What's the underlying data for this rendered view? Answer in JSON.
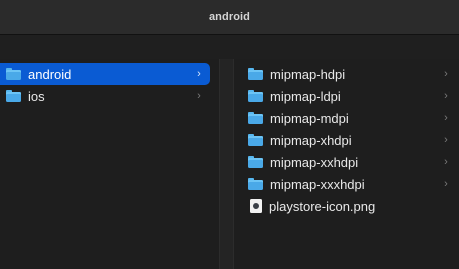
{
  "window": {
    "title": "android"
  },
  "column1": {
    "items": [
      {
        "label": "android",
        "icon": "folder-icon",
        "chevron": "›"
      },
      {
        "label": "ios",
        "icon": "folder-icon",
        "chevron": "›"
      }
    ]
  },
  "column2": {
    "items": [
      {
        "label": "mipmap-hdpi",
        "icon": "folder-icon",
        "chevron": "›"
      },
      {
        "label": "mipmap-ldpi",
        "icon": "folder-icon",
        "chevron": "›"
      },
      {
        "label": "mipmap-mdpi",
        "icon": "folder-icon",
        "chevron": "›"
      },
      {
        "label": "mipmap-xhdpi",
        "icon": "folder-icon",
        "chevron": "›"
      },
      {
        "label": "mipmap-xxhdpi",
        "icon": "folder-icon",
        "chevron": "›"
      },
      {
        "label": "mipmap-xxxhdpi",
        "icon": "folder-icon",
        "chevron": "›"
      },
      {
        "label": "playstore-icon.png",
        "icon": "image-file-icon"
      }
    ]
  },
  "colors": {
    "selection": "#0a5bd3",
    "folder": "#4aa9e8",
    "background": "#1e1e1e"
  }
}
